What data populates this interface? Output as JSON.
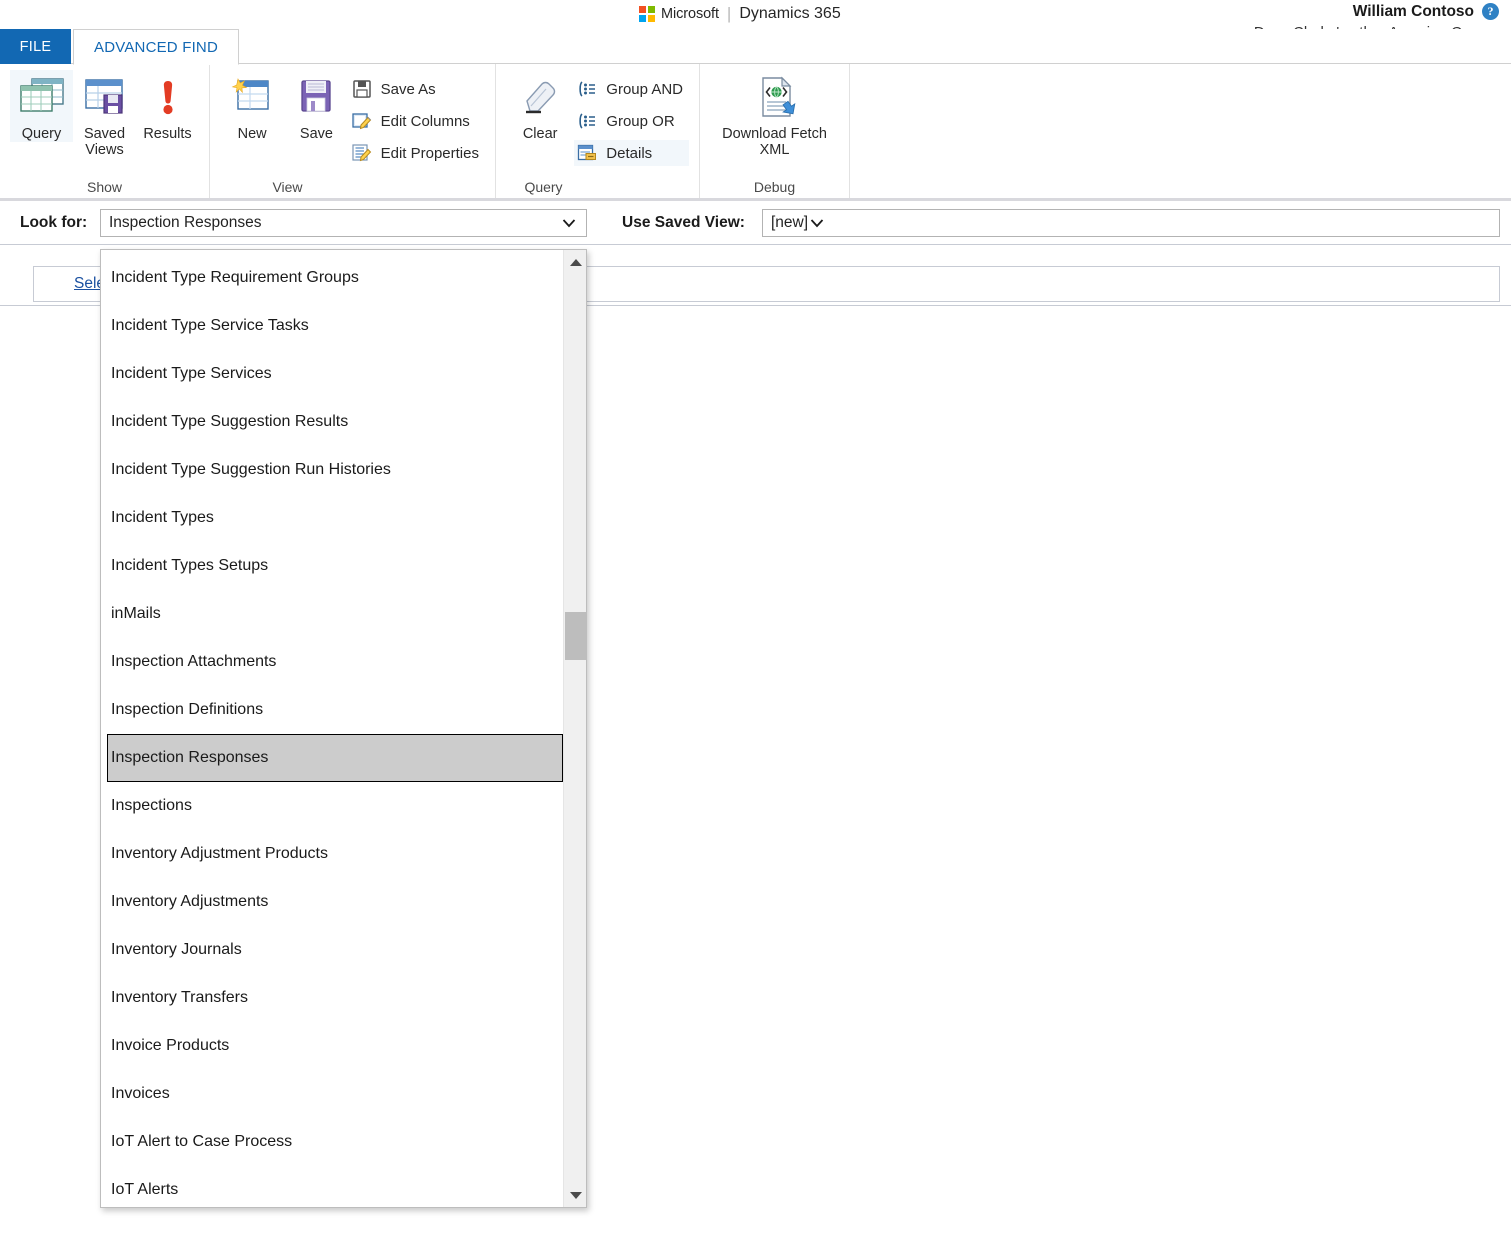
{
  "header": {
    "brand_vendor": "Microsoft",
    "brand_separator": "|",
    "brand_app": "Dynamics 365",
    "user_name": "William Contoso",
    "org_name": "Dave Clarke's other Amazing Org",
    "help_glyph": "?"
  },
  "tabs": {
    "file": "FILE",
    "advanced_find": "ADVANCED FIND"
  },
  "ribbon": {
    "groups": [
      {
        "label": "Show",
        "buttons": [
          {
            "label": "Query",
            "icon": "query-table-icon"
          },
          {
            "label": "Saved\nViews",
            "label_line1": "Saved",
            "label_line2": "Views",
            "icon": "saved-views-icon"
          },
          {
            "label": "Results",
            "icon": "results-exclamation-icon"
          }
        ]
      },
      {
        "label": "View",
        "buttons": [
          {
            "label": "New",
            "icon": "new-query-icon"
          },
          {
            "label": "Save",
            "icon": "save-floppy-icon"
          }
        ],
        "small_buttons": [
          {
            "label": "Save As",
            "icon": "save-as-icon"
          },
          {
            "label": "Edit Columns",
            "icon": "edit-columns-icon"
          },
          {
            "label": "Edit Properties",
            "icon": "edit-properties-icon"
          }
        ]
      },
      {
        "label": "Query",
        "buttons": [
          {
            "label": "Clear",
            "icon": "eraser-icon"
          }
        ],
        "small_buttons": [
          {
            "label": "Group AND",
            "icon": "group-and-icon"
          },
          {
            "label": "Group OR",
            "icon": "group-or-icon"
          },
          {
            "label": "Details",
            "icon": "details-icon"
          }
        ]
      },
      {
        "label": "Debug",
        "buttons": [
          {
            "label_line1": "Download Fetch",
            "label_line2": "XML",
            "icon": "download-fetch-xml-icon"
          }
        ]
      }
    ]
  },
  "query_bar": {
    "look_for_label": "Look for:",
    "look_for_value": "Inspection Responses",
    "use_saved_view_label": "Use Saved View:",
    "use_saved_view_value": "[new]"
  },
  "criteria_panel": {
    "select_link": "Select"
  },
  "dropdown": {
    "selected": "Inspection Responses",
    "items": [
      "Incident Type Requirement Groups",
      "Incident Type Service Tasks",
      "Incident Type Services",
      "Incident Type Suggestion Results",
      "Incident Type Suggestion Run Histories",
      "Incident Types",
      "Incident Types Setups",
      "inMails",
      "Inspection Attachments",
      "Inspection Definitions",
      "Inspection Responses",
      "Inspections",
      "Inventory Adjustment Products",
      "Inventory Adjustments",
      "Inventory Journals",
      "Inventory Transfers",
      "Invoice Products",
      "Invoices",
      "IoT Alert to Case Process",
      "IoT Alerts"
    ]
  },
  "colors": {
    "file_tab_blue": "#1268b3",
    "link_blue": "#1a50a0",
    "selected_row_gray": "#cccccc",
    "ribbon_divider": "#d8d8dd"
  }
}
